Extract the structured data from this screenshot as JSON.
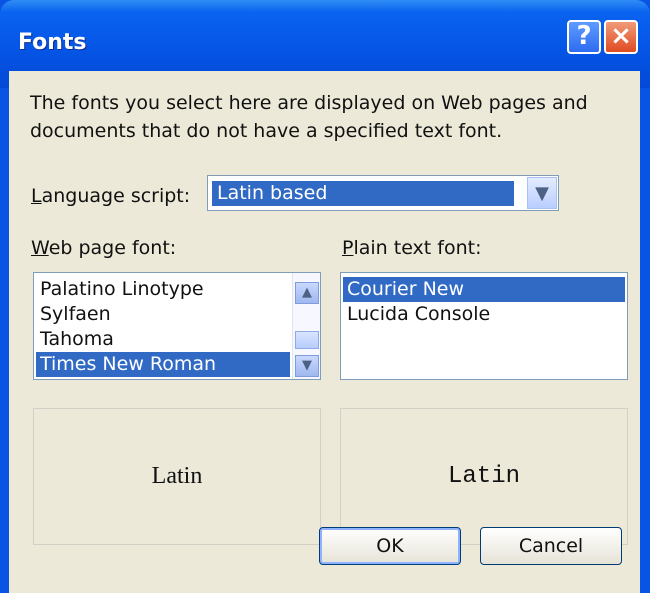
{
  "window": {
    "title": "Fonts",
    "help_button": "?",
    "close_button": "×"
  },
  "intro_text": "The fonts you select here are displayed on Web pages and documents that do not have a specified text font.",
  "language_script": {
    "label_prefix": "L",
    "label_rest": "anguage script:",
    "value": "Latin based",
    "dropdown_icon": "▼"
  },
  "web_font": {
    "label_prefix": "W",
    "label_rest": "eb page font:",
    "items": [
      "Palatino Linotype",
      "Sylfaen",
      "Tahoma",
      "Times New Roman"
    ],
    "selected_index": 3,
    "scroll_up": "▲",
    "scroll_down": "▼"
  },
  "plain_font": {
    "label_prefix": "P",
    "label_rest": "lain text font:",
    "items": [
      "Courier New",
      "Lucida Console"
    ],
    "selected_index": 0
  },
  "previews": {
    "web": "Latin",
    "plain": "Latin"
  },
  "buttons": {
    "ok": "OK",
    "cancel": "Cancel"
  }
}
